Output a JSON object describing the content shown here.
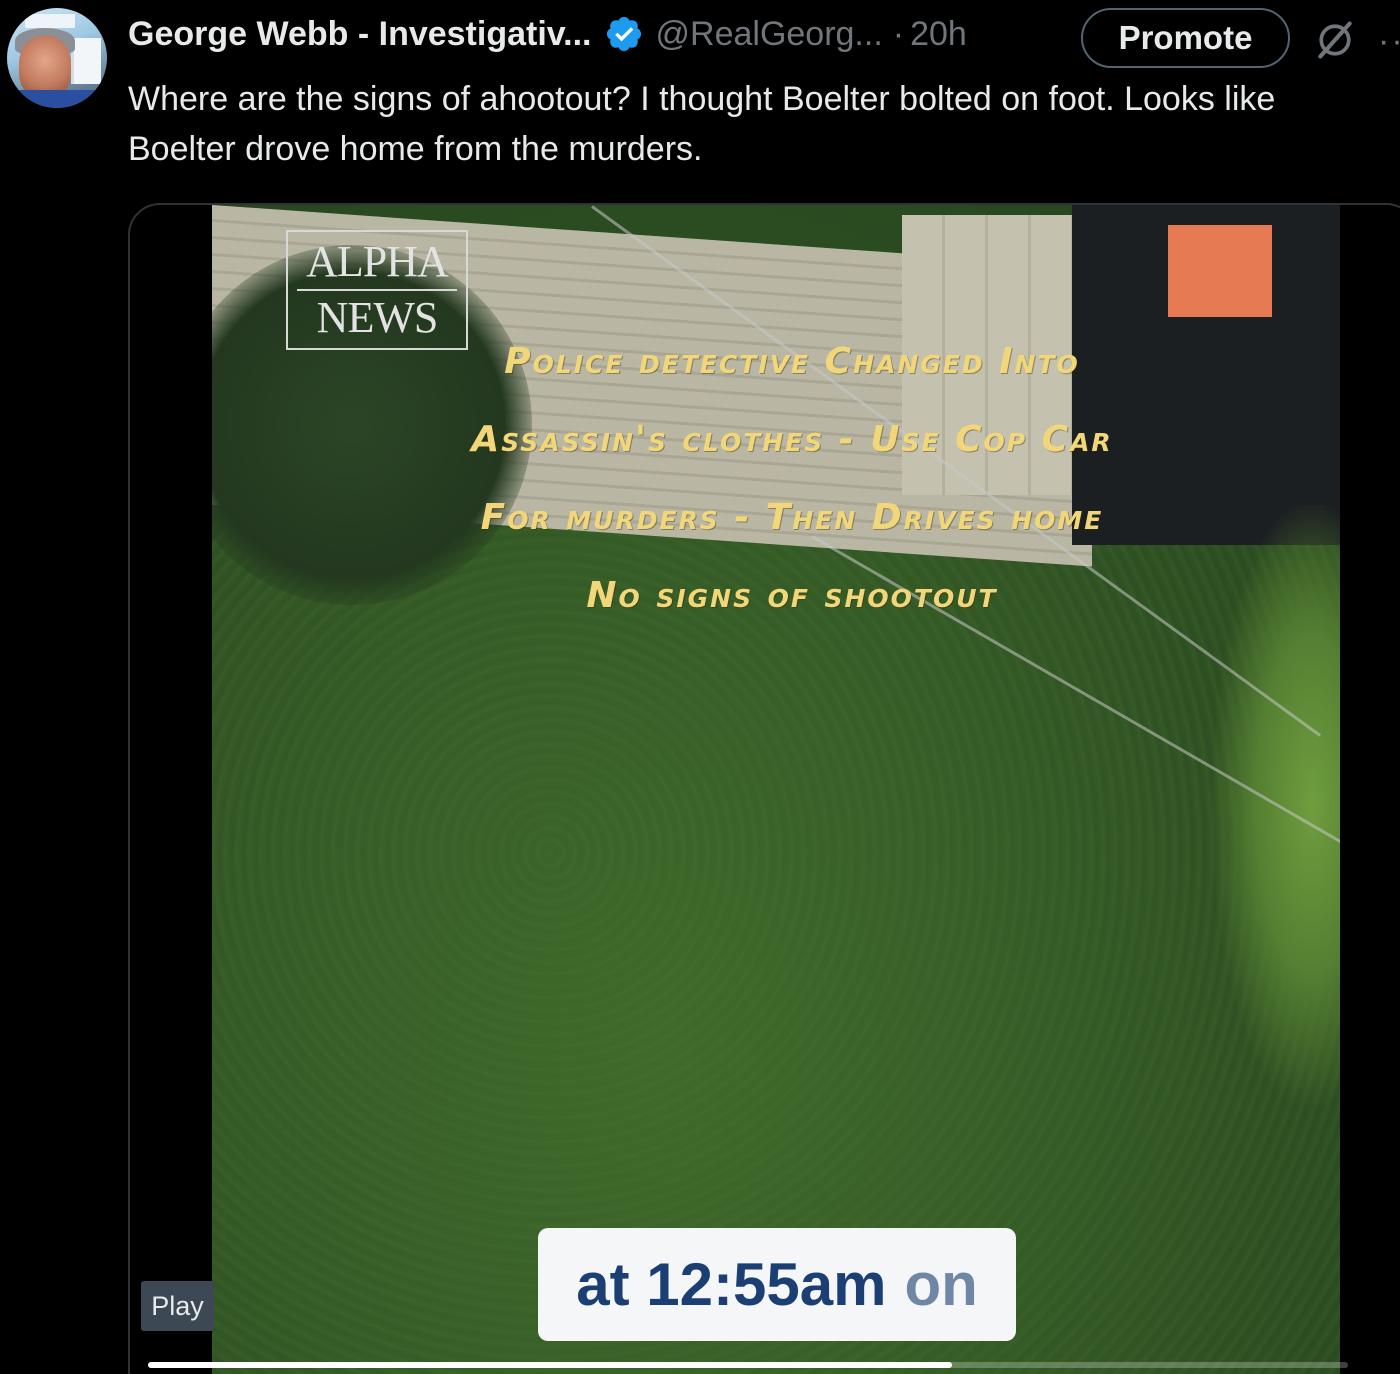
{
  "author": {
    "name": "George Webb - Investigativ...",
    "handle": "@RealGeorg...",
    "separator": "·",
    "time": "20h",
    "verified": true,
    "verified_color": "#1d9bf0"
  },
  "actions": {
    "promote_label": "Promote",
    "grok_icon": "grok-icon",
    "more_icon": "more-icon"
  },
  "tweet": {
    "text": "Where are the signs of ahootout?  I thought Boelter bolted on foot. Looks like Boelter drove home from the murders."
  },
  "video": {
    "logo_line1": "ALPHA",
    "logo_line2": "NEWS",
    "overlay_lines": [
      "Police detective Changed Into",
      "Assassin's clothes - Use Cop Car",
      "For murders - Then Drives home",
      "No signs of shootout"
    ],
    "caption_strong": "at 12:55am",
    "caption_soft": "on",
    "play_label": "Play",
    "progress": 0.67,
    "overlay_color": "#f2d77a",
    "caption_color": "#1b3f73"
  }
}
